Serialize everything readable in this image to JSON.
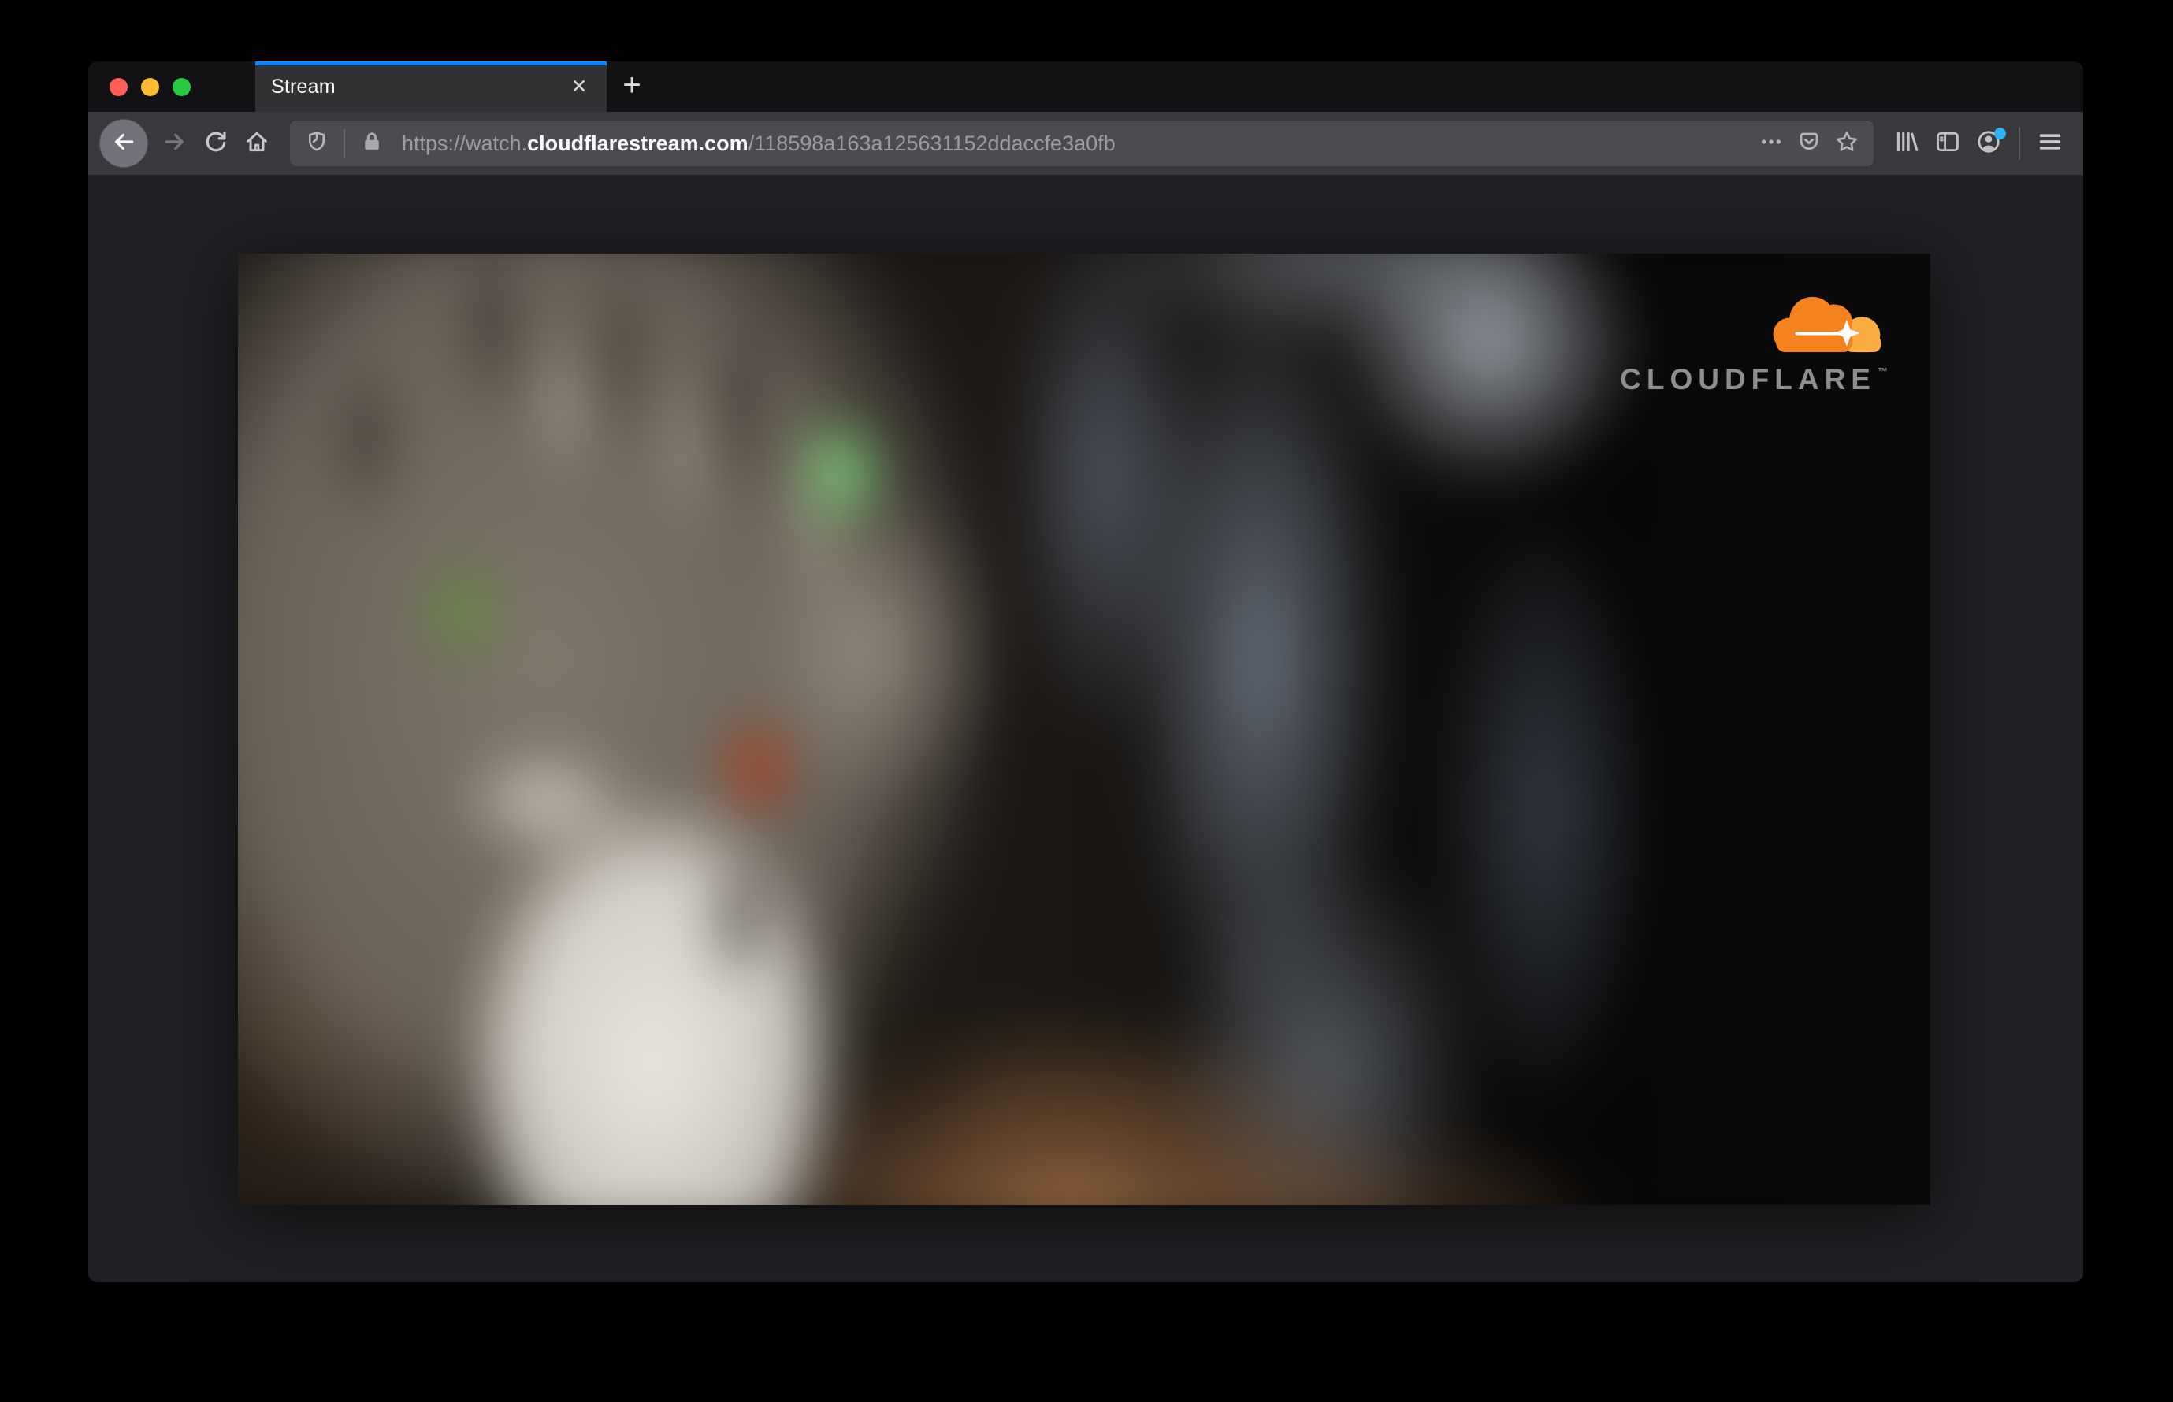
{
  "window": {
    "traffic_lights": [
      "close",
      "minimize",
      "zoom"
    ]
  },
  "tab_bar": {
    "active_tab": {
      "title": "Stream",
      "close_label": "✕"
    },
    "new_tab_label": "+"
  },
  "toolbar": {
    "buttons": [
      "back",
      "forward",
      "reload",
      "home"
    ],
    "url": {
      "prefix": "https://watch.",
      "domain": "cloudflarestream.com",
      "path": "/118598a163a125631152ddaccfe3a0fb"
    },
    "urlbar_icons": [
      "tracking-protection-shield",
      "lock",
      "page-actions-dots",
      "pocket",
      "bookmark-star"
    ],
    "right_icons": [
      "library",
      "sidebar",
      "account",
      "menu"
    ]
  },
  "video_player": {
    "brand": "CLOUDFLARE",
    "brand_mark": "™"
  },
  "colors": {
    "accent_blue": "#0a84ff",
    "account_badge_blue": "#2bb3f5",
    "traffic_red": "#ff5f57",
    "traffic_yellow": "#febc2e",
    "traffic_green": "#28c840",
    "cloudflare_orange": "#f6821f",
    "cloudflare_orange_light": "#fbad41",
    "tab_bar_bg": "#121214",
    "toolbar_bg": "#38383d",
    "urlbar_bg": "#4b4b52",
    "content_bg": "#212125"
  }
}
